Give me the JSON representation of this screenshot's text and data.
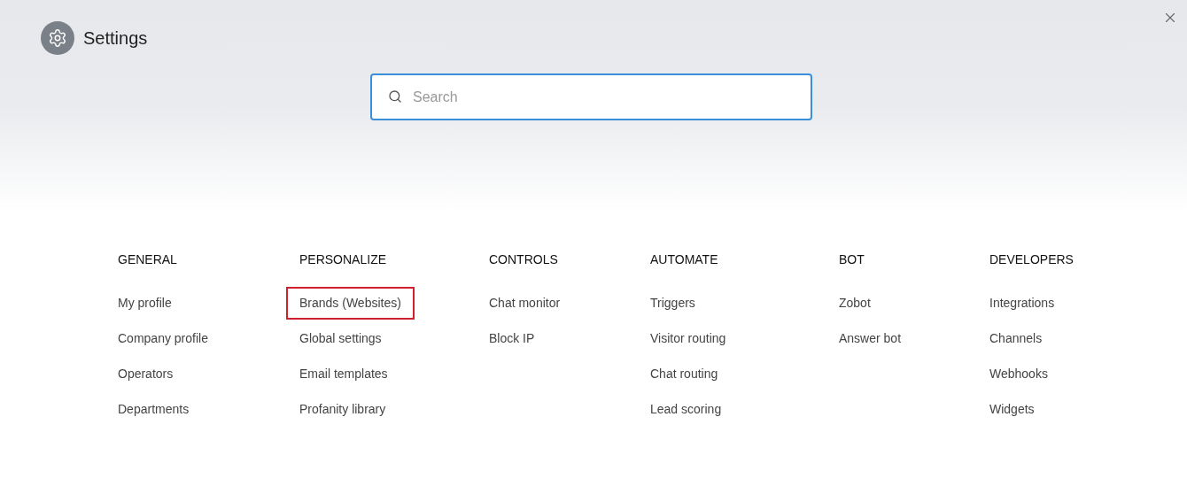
{
  "header": {
    "title": "Settings"
  },
  "search": {
    "placeholder": "Search"
  },
  "sections": [
    {
      "heading": "GENERAL",
      "items": [
        {
          "label": "My profile",
          "highlighted": false
        },
        {
          "label": "Company profile",
          "highlighted": false
        },
        {
          "label": "Operators",
          "highlighted": false
        },
        {
          "label": "Departments",
          "highlighted": false
        }
      ]
    },
    {
      "heading": "PERSONALIZE",
      "items": [
        {
          "label": "Brands (Websites)",
          "highlighted": true
        },
        {
          "label": "Global settings",
          "highlighted": false
        },
        {
          "label": "Email templates",
          "highlighted": false
        },
        {
          "label": "Profanity library",
          "highlighted": false
        }
      ]
    },
    {
      "heading": "CONTROLS",
      "items": [
        {
          "label": "Chat monitor",
          "highlighted": false
        },
        {
          "label": "Block IP",
          "highlighted": false
        }
      ]
    },
    {
      "heading": "AUTOMATE",
      "items": [
        {
          "label": "Triggers",
          "highlighted": false
        },
        {
          "label": "Visitor routing",
          "highlighted": false
        },
        {
          "label": "Chat routing",
          "highlighted": false
        },
        {
          "label": "Lead scoring",
          "highlighted": false
        }
      ]
    },
    {
      "heading": "BOT",
      "items": [
        {
          "label": "Zobot",
          "highlighted": false
        },
        {
          "label": "Answer bot",
          "highlighted": false
        }
      ]
    },
    {
      "heading": "DEVELOPERS",
      "items": [
        {
          "label": "Integrations",
          "highlighted": false
        },
        {
          "label": "Channels",
          "highlighted": false
        },
        {
          "label": "Webhooks",
          "highlighted": false
        },
        {
          "label": "Widgets",
          "highlighted": false
        }
      ]
    }
  ]
}
